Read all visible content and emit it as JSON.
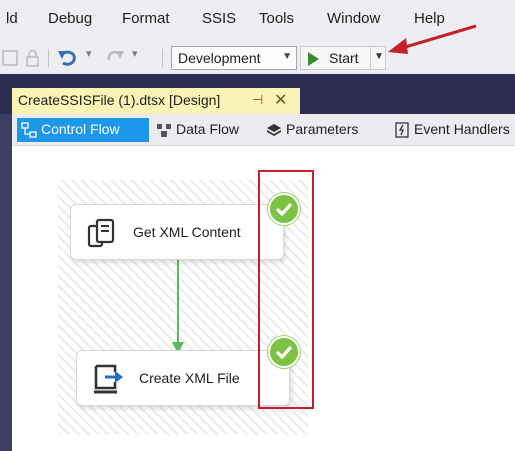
{
  "menu": {
    "items": [
      "ld",
      "Debug",
      "Format",
      "SSIS",
      "Tools",
      "Window",
      "Help"
    ]
  },
  "toolbar": {
    "config_value": "Development",
    "start_label": "Start"
  },
  "document_tab": {
    "title": "CreateSSISFile (1).dtsx [Design]",
    "pin_glyph": "⊣",
    "close_glyph": "✕"
  },
  "designer_tabs": [
    {
      "label": "Control Flow",
      "icon": "control-flow-icon",
      "active": true
    },
    {
      "label": "Data Flow",
      "icon": "data-flow-icon",
      "active": false
    },
    {
      "label": "Parameters",
      "icon": "parameters-icon",
      "active": false
    },
    {
      "label": "Event Handlers",
      "icon": "event-handlers-icon",
      "active": false
    }
  ],
  "tasks": [
    {
      "label": "Get XML Content",
      "icon": "xml-content-task-icon",
      "status": "success"
    },
    {
      "label": "Create XML File",
      "icon": "file-system-task-icon",
      "status": "success"
    }
  ],
  "colors": {
    "accent": "#1c97ea",
    "success": "#7cc245",
    "connector": "#5cb85c",
    "highlight": "#c4202a",
    "tab_bar": "#2d2d54",
    "active_doc_tab": "#fbf3b5"
  }
}
